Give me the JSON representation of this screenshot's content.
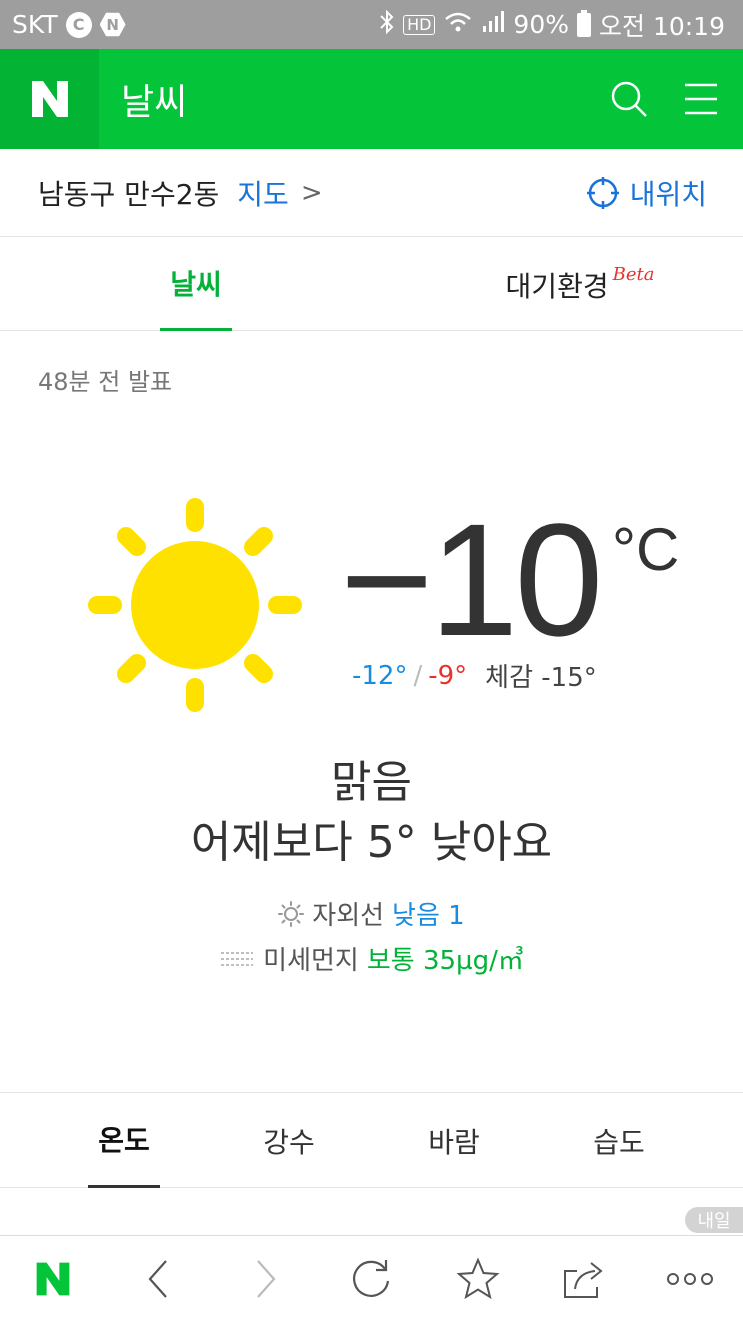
{
  "status_bar": {
    "carrier": "SKT",
    "icon_c": "C",
    "icon_n": "N",
    "hd_label": "HD",
    "battery": "90%",
    "time": "오전 10:19"
  },
  "app_bar": {
    "logo": "N",
    "title": "날씨",
    "icons": [
      "search-icon",
      "menu-icon"
    ],
    "color": "#04c43a"
  },
  "location": {
    "name": "남동구 만수2동",
    "map_link": "지도",
    "arrow": ">",
    "my_location": "내위치"
  },
  "tabs": {
    "weather": "날씨",
    "air": "대기환경",
    "beta": "Beta"
  },
  "current": {
    "announced": "48분 전 발표",
    "temperature": "−10",
    "unit": "°C",
    "min": "-12°",
    "separator": "/",
    "max": "-9°",
    "feels_like": "체감 -15°",
    "condition": "맑음",
    "comparison": "어제보다 5° 낮아요",
    "uv_label": "자외선",
    "uv_value": "낮음 1",
    "dust_label": "미세먼지",
    "dust_value": "보통 35µg/㎥",
    "icon": "sun-icon"
  },
  "sub_tabs": [
    "온도",
    "강수",
    "바람",
    "습도"
  ],
  "tomorrow_tag": "내일",
  "toolbar": {
    "logo": "N",
    "icons": [
      "back-icon",
      "forward-icon",
      "refresh-icon",
      "bookmark-star-icon",
      "share-icon",
      "more-icon"
    ]
  }
}
